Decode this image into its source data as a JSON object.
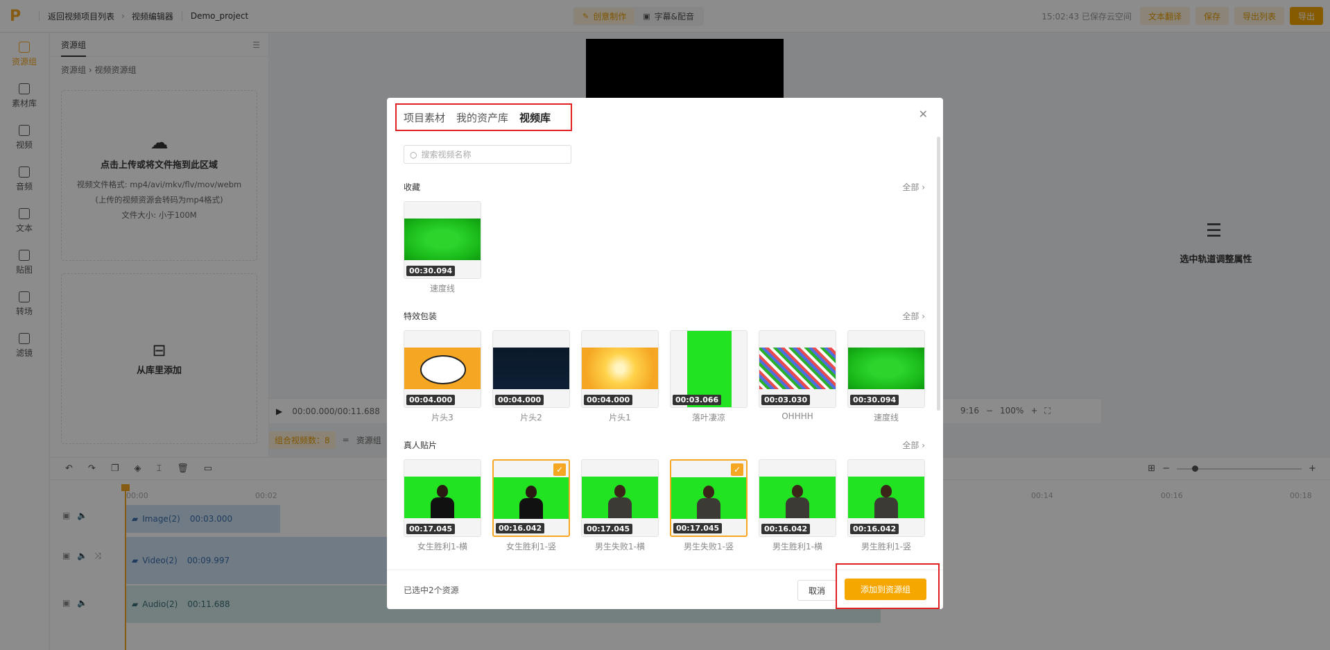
{
  "topbar": {
    "logo": "P",
    "back_label": "返回视频项目列表",
    "editor_label": "视频编辑器",
    "project_name": "Demo_project",
    "tabs": [
      {
        "label": "创意制作",
        "icon": "wand-icon"
      },
      {
        "label": "字幕&配音",
        "icon": "subtitle-icon"
      }
    ],
    "saved_text": "15:02:43 已保存云空间",
    "translate_label": "文本翻译",
    "save_label": "保存",
    "export_list_label": "导出列表",
    "export_label": "导出"
  },
  "leftnav": [
    {
      "label": "资源组",
      "icon": "folder-icon",
      "active": true
    },
    {
      "label": "素材库",
      "icon": "media-library-icon"
    },
    {
      "label": "视频",
      "icon": "film-icon"
    },
    {
      "label": "音频",
      "icon": "music-icon"
    },
    {
      "label": "文本",
      "icon": "text-icon"
    },
    {
      "label": "贴图",
      "icon": "sticker-icon"
    },
    {
      "label": "转场",
      "icon": "transition-icon"
    },
    {
      "label": "滤镜",
      "icon": "filter-icon"
    }
  ],
  "resource": {
    "tab": "资源组",
    "crumb_root": "资源组",
    "crumb_current": "视频资源组",
    "upload_title": "点击上传或将文件拖到此区域",
    "upload_format": "视频文件格式: mp4/avi/mkv/flv/mov/webm",
    "upload_note": "(上传的视频资源会转码为mp4格式)",
    "upload_size": "文件大小: 小于100M",
    "library_label": "从库里添加"
  },
  "preview": {
    "time": "00:00.000/00:11.688",
    "ratio": "9:16",
    "zoom": "100%",
    "combo_label": "组合视频数：8",
    "eq": "=",
    "resgroup": "资源组"
  },
  "props": {
    "hint": "选中轨道调整属性"
  },
  "timeline": {
    "ticks": [
      "00:00",
      "00:02",
      "00:14",
      "00:16",
      "00:18"
    ],
    "tracks": [
      {
        "name": "Image(2)",
        "duration": "00:03.000"
      },
      {
        "name": "Video(2)",
        "duration": "00:09.997"
      },
      {
        "name": "Audio(2)",
        "duration": "00:11.688"
      }
    ]
  },
  "modal": {
    "tabs": [
      "项目素材",
      "我的资产库",
      "视频库"
    ],
    "search_placeholder": "搜索视频名称",
    "all_label": "全部",
    "sections": [
      {
        "title": "收藏",
        "items": [
          {
            "name": "速度线",
            "duration": "00:30.094",
            "img": "green",
            "selected": false
          }
        ]
      },
      {
        "title": "特效包装",
        "items": [
          {
            "name": "片头3",
            "duration": "00:04.000",
            "img": "cloud",
            "selected": false
          },
          {
            "name": "片头2",
            "duration": "00:04.000",
            "img": "dark",
            "selected": false
          },
          {
            "name": "片头1",
            "duration": "00:04.000",
            "img": "burst",
            "selected": false
          },
          {
            "name": "落叶凄凉",
            "duration": "00:03.066",
            "img": "vgreen",
            "selected": false
          },
          {
            "name": "OHHHH",
            "duration": "00:03.030",
            "img": "ohh",
            "selected": false
          },
          {
            "name": "速度线",
            "duration": "00:30.094",
            "img": "green",
            "selected": false
          }
        ]
      },
      {
        "title": "真人贴片",
        "items": [
          {
            "name": "女生胜利1-横",
            "duration": "00:17.045",
            "img": "female",
            "selected": false
          },
          {
            "name": "女生胜利1-竖",
            "duration": "00:16.042",
            "img": "female",
            "selected": true
          },
          {
            "name": "男生失败1-横",
            "duration": "00:17.045",
            "img": "male",
            "selected": false
          },
          {
            "name": "男生失败1-竖",
            "duration": "00:17.045",
            "img": "male",
            "selected": true
          },
          {
            "name": "男生胜利1-横",
            "duration": "00:16.042",
            "img": "male",
            "selected": false
          },
          {
            "name": "男生胜利1-竖",
            "duration": "00:16.042",
            "img": "male",
            "selected": false
          }
        ]
      }
    ],
    "selected_info": "已选中2个资源",
    "cancel_label": "取消",
    "add_label": "添加到资源组"
  },
  "colors": {
    "accent": "#f5a623",
    "highlight_frame": "#e02020"
  }
}
